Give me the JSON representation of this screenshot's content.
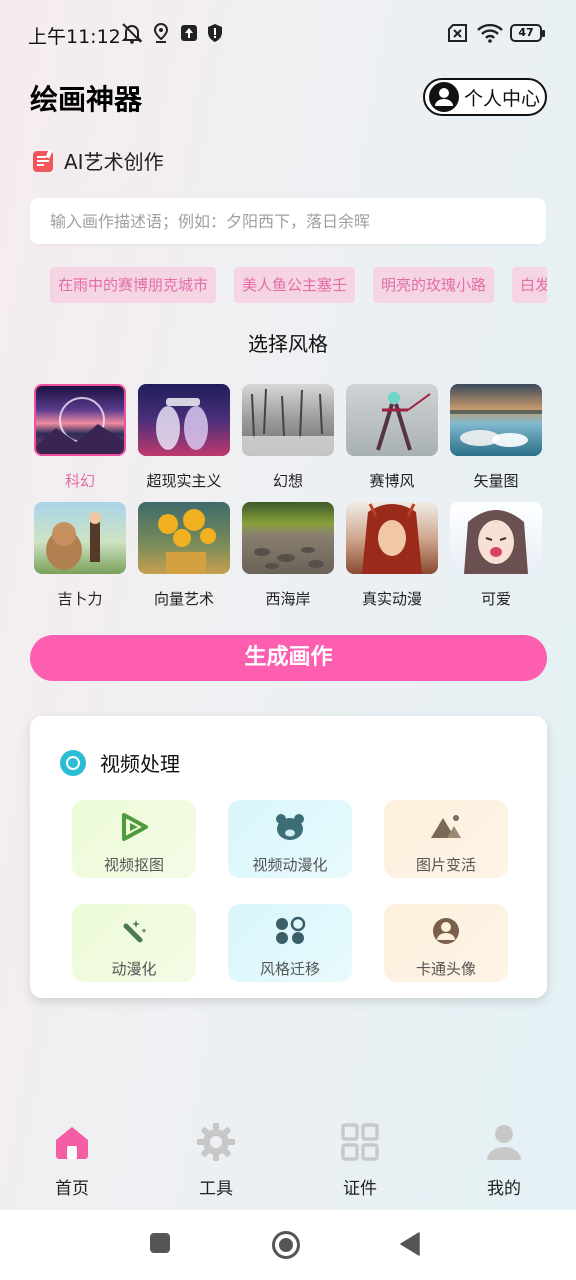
{
  "status_bar": {
    "time": "上午11:12",
    "battery": "47",
    "icons": [
      "bell-off-icon",
      "location-icon",
      "upload-icon",
      "shield-icon",
      "sim-off-icon",
      "wifi-icon",
      "battery-icon"
    ]
  },
  "header": {
    "title": "绘画神器",
    "user_center_label": "个人中心"
  },
  "ai_section": {
    "label": "AI艺术创作",
    "prompt_placeholder": "输入画作描述语；例如：夕阳西下，落日余晖"
  },
  "suggestion_chips": [
    "在雨中的赛博朋克城市",
    "美人鱼公主塞壬",
    "明亮的玫瑰小路",
    "白发"
  ],
  "style_section": {
    "title": "选择风格",
    "styles": [
      {
        "label": "科幻",
        "selected": true
      },
      {
        "label": "超现实主义",
        "selected": false
      },
      {
        "label": "幻想",
        "selected": false
      },
      {
        "label": "赛博风",
        "selected": false
      },
      {
        "label": "矢量图",
        "selected": false
      },
      {
        "label": "吉卜力",
        "selected": false
      },
      {
        "label": "向量艺术",
        "selected": false
      },
      {
        "label": "西海岸",
        "selected": false
      },
      {
        "label": "真实动漫",
        "selected": false
      },
      {
        "label": "可爱",
        "selected": false
      }
    ]
  },
  "generate_label": "生成画作",
  "video_section": {
    "title": "视频处理",
    "tools": [
      {
        "label": "视频抠图",
        "icon": "video-play-icon"
      },
      {
        "label": "视频动漫化",
        "icon": "bear-face-icon"
      },
      {
        "label": "图片变活",
        "icon": "mountain-image-icon"
      },
      {
        "label": "动漫化",
        "icon": "magic-wand-icon"
      },
      {
        "label": "风格迁移",
        "icon": "shapes-icon"
      },
      {
        "label": "卡通头像",
        "icon": "avatar-icon"
      }
    ]
  },
  "bottom_nav": [
    {
      "label": "首页",
      "icon": "home-icon",
      "active": true
    },
    {
      "label": "工具",
      "icon": "gear-icon",
      "active": false
    },
    {
      "label": "证件",
      "icon": "grid-icon",
      "active": false
    },
    {
      "label": "我的",
      "icon": "user-icon",
      "active": false
    }
  ],
  "colors": {
    "accent": "#fd5eb0",
    "chip_bg": "#f5d4e4",
    "chip_text": "#e26ea6",
    "nav_active": "#f35ea5",
    "nav_inactive": "#c8c8c8"
  }
}
